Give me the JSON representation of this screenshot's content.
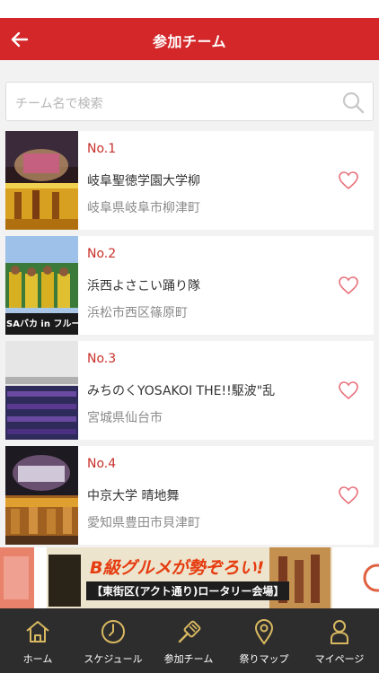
{
  "header": {
    "title": "参加チーム"
  },
  "search": {
    "placeholder": "チーム名で検索"
  },
  "teams": [
    {
      "num": "No.1",
      "name": "岐阜聖徳学園大学柳",
      "place": "岐阜県岐阜市柳津町"
    },
    {
      "num": "No.2",
      "name": "浜西よさこい踊り隊",
      "place": "浜松市西区篠原町"
    },
    {
      "num": "No.3",
      "name": "みちのくYOSAKOI THE!!駆波\"乱",
      "place": "宮城県仙台市"
    },
    {
      "num": "No.4",
      "name": "中京大学 晴地舞",
      "place": "愛知県豊田市貝津町"
    }
  ],
  "thumb_overlay": {
    "team2": "SAバカ in フルーツ"
  },
  "banner": {
    "headline": "B級グルメが勢ぞろい!",
    "sub": "【東街区(アクト通り)ロータリー会場】"
  },
  "tabs": [
    {
      "label": "ホーム",
      "icon": "home-icon"
    },
    {
      "label": "スケジュール",
      "icon": "clock-icon"
    },
    {
      "label": "参加チーム",
      "icon": "naruko-icon"
    },
    {
      "label": "祭りマップ",
      "icon": "map-pin-icon"
    },
    {
      "label": "マイページ",
      "icon": "person-icon"
    }
  ],
  "colors": {
    "accent": "#d3272a",
    "tabbar": "#2d2d2d",
    "number": "#c8302a"
  }
}
